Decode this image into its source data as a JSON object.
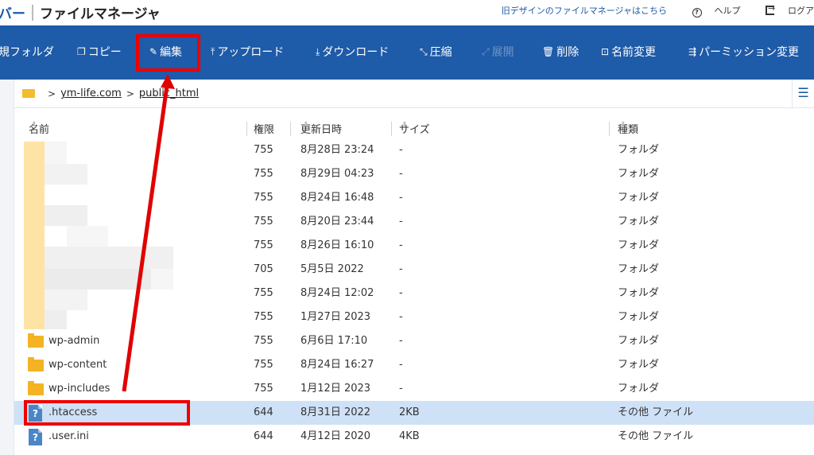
{
  "app": {
    "brand_prefix": "バー",
    "title": "ファイルマネージャ",
    "links": {
      "old_design": "旧デザインのファイルマネージャはこちら",
      "help": "ヘルプ",
      "logout": "ログア"
    }
  },
  "toolbar": {
    "new_folder": "規フォルダ",
    "copy": "コピー",
    "edit": "編集",
    "upload": "アップロード",
    "download": "ダウンロード",
    "compress": "圧縮",
    "extract": "展開",
    "delete": "削除",
    "rename": "名前変更",
    "permission": "パーミッション変更"
  },
  "breadcrumb": {
    "domain": "ym-life.com",
    "folder": "public_html",
    "sep": ">"
  },
  "columns": {
    "name": "名前",
    "perm": "権限",
    "date": "更新日時",
    "size": "サイズ",
    "kind": "種類"
  },
  "rows": [
    {
      "name": "",
      "perm": "755",
      "date": "8月28日 23:24",
      "size": "-",
      "kind": "フォルダ"
    },
    {
      "name": "",
      "perm": "755",
      "date": "8月29日 04:23",
      "size": "-",
      "kind": "フォルダ"
    },
    {
      "name": "",
      "perm": "755",
      "date": "8月24日 16:48",
      "size": "-",
      "kind": "フォルダ"
    },
    {
      "name": "",
      "perm": "755",
      "date": "8月20日 23:44",
      "size": "-",
      "kind": "フォルダ"
    },
    {
      "name": "",
      "perm": "755",
      "date": "8月26日 16:10",
      "size": "-",
      "kind": "フォルダ"
    },
    {
      "name": "",
      "perm": "705",
      "date": "5月5日 2022",
      "size": "-",
      "kind": "フォルダ"
    },
    {
      "name": "",
      "perm": "755",
      "date": "8月24日 12:02",
      "size": "-",
      "kind": "フォルダ"
    },
    {
      "name": "",
      "perm": "755",
      "date": "1月27日 2023",
      "size": "-",
      "kind": "フォルダ"
    },
    {
      "name": "wp-admin",
      "perm": "755",
      "date": "6月6日 17:10",
      "size": "-",
      "kind": "フォルダ"
    },
    {
      "name": "wp-content",
      "perm": "755",
      "date": "8月24日 16:27",
      "size": "-",
      "kind": "フォルダ"
    },
    {
      "name": "wp-includes",
      "perm": "755",
      "date": "1月12日 2023",
      "size": "-",
      "kind": "フォルダ"
    },
    {
      "name": ".htaccess",
      "perm": "644",
      "date": "8月31日 2022",
      "size": "2KB",
      "kind": "その他 ファイル"
    },
    {
      "name": ".user.ini",
      "perm": "644",
      "date": "4月12日 2020",
      "size": "4KB",
      "kind": "その他 ファイル"
    }
  ],
  "colors": {
    "toolbar": "#1e5ba8",
    "annotation": "#e00000",
    "selected_row": "#cfe1f6",
    "folder": "#f3b322"
  }
}
